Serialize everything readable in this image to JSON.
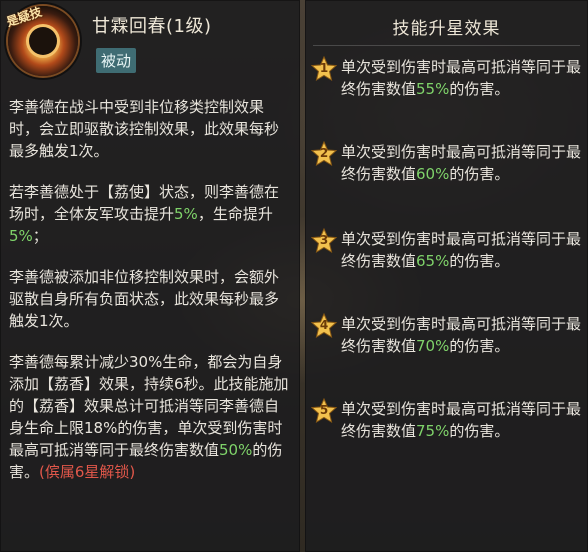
{
  "skill": {
    "badge_text": "是疑技",
    "title": "甘霖回春(1级)",
    "type": "被动",
    "paragraphs": [
      [
        {
          "t": "李善德在战斗中受到非位移类控制效果时，会立即驱散该控制效果，此效果每秒最多触发1次。"
        }
      ],
      [
        {
          "t": "若李善德处于【荔使】状态，则李善德在场时，全体友军攻击提升"
        },
        {
          "t": "5%",
          "c": "hl"
        },
        {
          "t": "，生命提升"
        },
        {
          "t": "5%",
          "c": "hl"
        },
        {
          "t": "；"
        }
      ],
      [
        {
          "t": "李善德被添加非位移控制效果时，会额外驱散自身所有负面状态，此效果每秒最多触发1次。"
        }
      ],
      [
        {
          "t": "李善德每累计减少30%生命，都会为自身添加【荔香】效果，持续6秒。此技能施加的【荔香】效果总计可抵消等同李善德自身生命上限18%的伤害，单次受到伤害时最高可抵消等同于最终伤害数值"
        },
        {
          "t": "50%",
          "c": "hl"
        },
        {
          "t": "的伤害。"
        },
        {
          "t": "(傧属6星解锁)",
          "c": "lock"
        }
      ]
    ]
  },
  "upgrade": {
    "title": "技能升星效果",
    "rows": [
      {
        "star": "1",
        "pre": "单次受到伤害时最高可抵消等同于最终伤害数值",
        "val": "55%",
        "post": "的伤害。"
      },
      {
        "star": "2",
        "pre": "单次受到伤害时最高可抵消等同于最终伤害数值",
        "val": "60%",
        "post": "的伤害。"
      },
      {
        "star": "3",
        "pre": "单次受到伤害时最高可抵消等同于最终伤害数值",
        "val": "65%",
        "post": "的伤害。"
      },
      {
        "star": "4",
        "pre": "单次受到伤害时最高可抵消等同于最终伤害数值",
        "val": "70%",
        "post": "的伤害。"
      },
      {
        "star": "5",
        "pre": "单次受到伤害时最高可抵消等同于最终伤害数值",
        "val": "75%",
        "post": "的伤害。"
      }
    ]
  },
  "colors": {
    "highlight": "#7fd36a",
    "lock": "#e0574a",
    "star": "#f2c14e",
    "passive_bg": "#3f6c73"
  },
  "icons": {
    "badge": "skill-emblem-icon",
    "star": "star-icon"
  }
}
